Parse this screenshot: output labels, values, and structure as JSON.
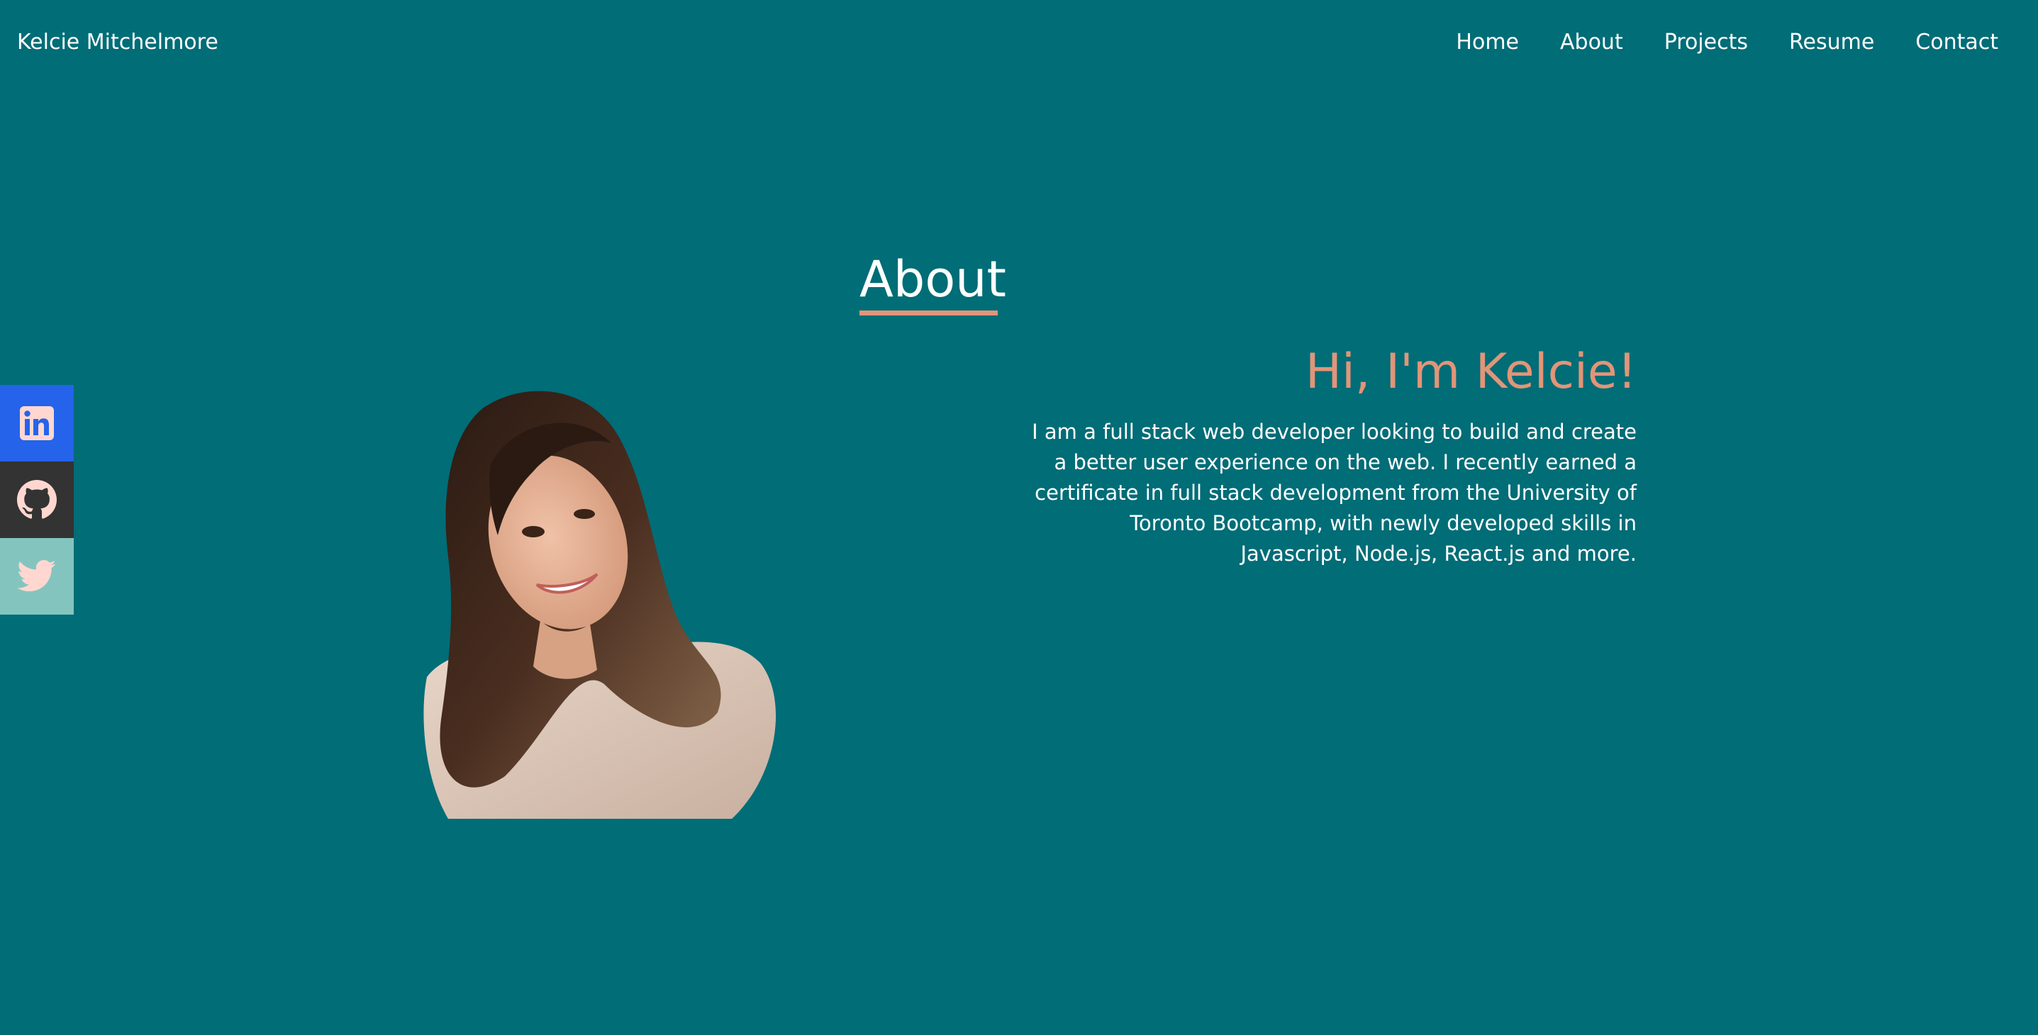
{
  "header": {
    "site_name": "Kelcie Mitchelmore",
    "nav": [
      {
        "label": "Home"
      },
      {
        "label": "About"
      },
      {
        "label": "Projects"
      },
      {
        "label": "Resume"
      },
      {
        "label": "Contact"
      }
    ]
  },
  "social": [
    {
      "name": "linkedin",
      "icon": "linkedin-icon",
      "color": "#2563eb"
    },
    {
      "name": "github",
      "icon": "github-icon",
      "color": "#333333"
    },
    {
      "name": "twitter",
      "icon": "twitter-icon",
      "color": "#83c5be"
    }
  ],
  "about": {
    "heading": "About",
    "greeting": "Hi, I'm Kelcie!",
    "bio": "I am a full stack web developer looking to build and create a better user experience on the web. I recently earned a certificate in full stack development from the University of Toronto Bootcamp, with newly developed skills in Javascript, Node.js, React.js and more."
  },
  "colors": {
    "background": "#006d77",
    "accent": "#e29578",
    "text": "#ffffff"
  }
}
